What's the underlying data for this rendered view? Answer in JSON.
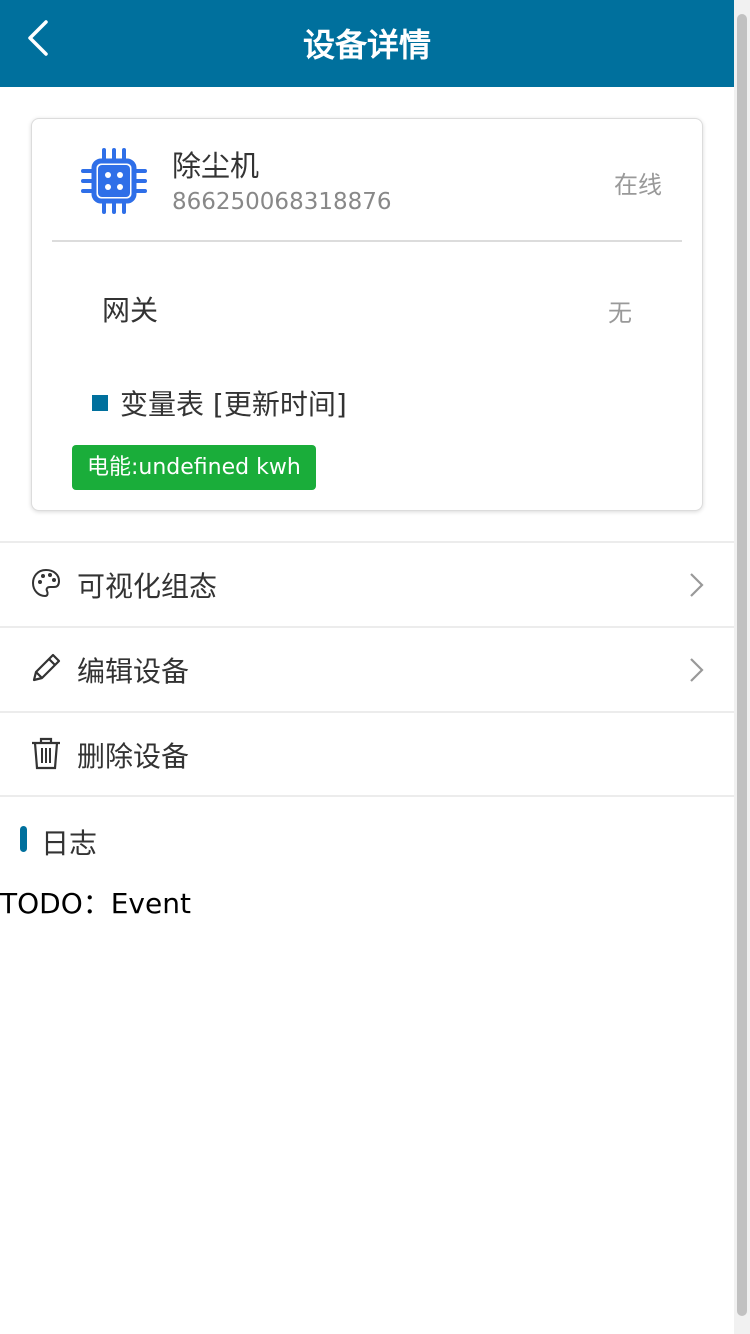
{
  "header": {
    "title": "设备详情",
    "back_icon": "chevron-left-icon"
  },
  "device": {
    "icon": "chip-icon",
    "icon_color": "#2f6fe8",
    "name": "除尘机",
    "id": "866250068318876",
    "status": "在线",
    "gateway_label": "网关",
    "gateway_value": "无",
    "variable_title": "变量表 [更新时间]",
    "energy_badge": "电能:undefined kwh",
    "badge_color": "#1aad3a"
  },
  "menu": [
    {
      "label": "可视化组态",
      "icon": "palette-icon",
      "has_arrow": true
    },
    {
      "label": "编辑设备",
      "icon": "pencil-icon",
      "has_arrow": true
    },
    {
      "label": "删除设备",
      "icon": "trash-icon",
      "has_arrow": false
    }
  ],
  "log": {
    "title": "日志",
    "content": "TODO：Event"
  },
  "colors": {
    "primary": "#00709d"
  }
}
